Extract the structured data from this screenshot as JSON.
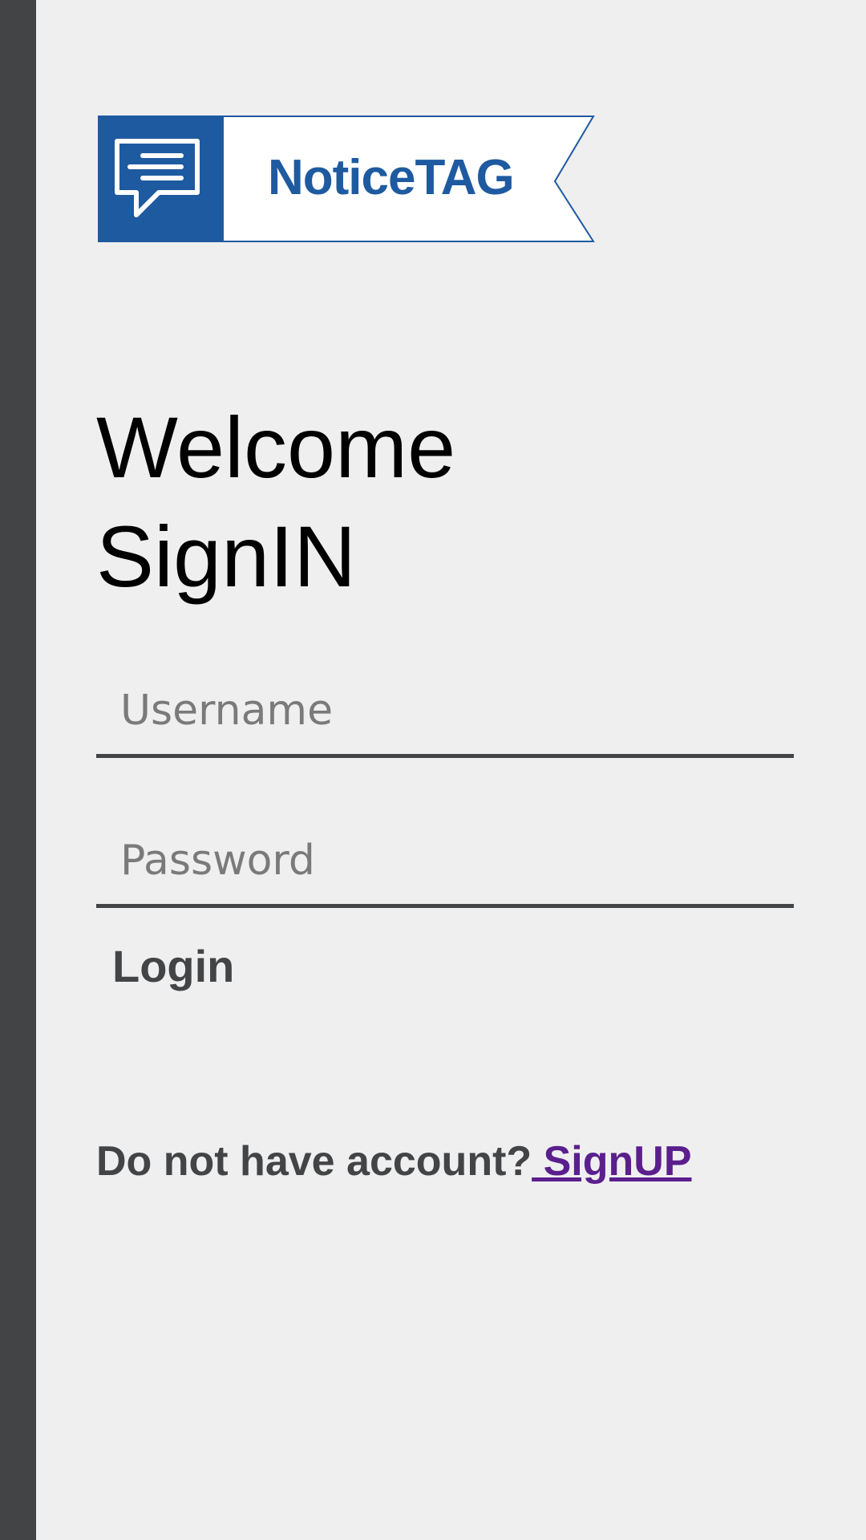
{
  "brand": {
    "name": "NoticeTAG",
    "primary_color": "#1e5aa0",
    "logo_icon": "chat-bubble-icon"
  },
  "heading": {
    "line1": "Welcome",
    "line2": "SignIN"
  },
  "form": {
    "username_placeholder": "Username",
    "username_value": "",
    "password_placeholder": "Password",
    "password_value": "",
    "login_label": "Login"
  },
  "signup": {
    "prompt": "Do not have account?",
    "link_label": " SignUP",
    "link_color": "#5a1f8c"
  },
  "theme": {
    "background": "#efeff0",
    "side_bar": "#434446",
    "text_dark": "#434446"
  }
}
